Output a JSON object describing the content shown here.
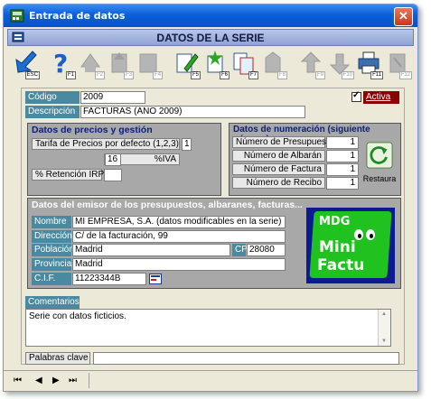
{
  "window": {
    "title": "Entrada de datos",
    "close_glyph": "✕"
  },
  "header": {
    "title": "DATOS DE LA SERIE"
  },
  "toolbar": {
    "buttons": [
      {
        "icon": "exit-icon",
        "key": "ESC"
      },
      {
        "icon": "help-icon",
        "key": "F1"
      },
      {
        "icon": "disabled-icon-1",
        "key": "F2"
      },
      {
        "icon": "disabled-icon-2",
        "key": "F3"
      },
      {
        "icon": "disabled-icon-3",
        "key": "F4"
      },
      {
        "icon": "edit-icon",
        "key": "F5"
      },
      {
        "icon": "new-icon",
        "key": "F6"
      },
      {
        "icon": "copy-icon",
        "key": "F7"
      },
      {
        "icon": "disabled-icon-4",
        "key": "F8"
      },
      {
        "icon": "disabled-icon-5",
        "key": "F9"
      },
      {
        "icon": "disabled-icon-6",
        "key": "F10"
      },
      {
        "icon": "print-icon",
        "key": "F11"
      },
      {
        "icon": "disabled-icon-7",
        "key": "F12"
      }
    ]
  },
  "form": {
    "codigo_label": "Código",
    "codigo_value": "2009",
    "descripcion_label": "Descripción",
    "descripcion_value": "FACTURAS (AÑO 2009)",
    "activa_label": "Activa",
    "activa_checked": "✓"
  },
  "precios": {
    "title": "Datos de precios y gestión",
    "tarifa_label": "Tarifa de Precios por defecto (1,2,3)",
    "tarifa_value": "1",
    "iva_label": "%IVA",
    "iva_value": "16",
    "irpf_label": "% Retención IRPF",
    "irpf_value": ""
  },
  "numeracion": {
    "title": "Datos de numeración (siguiente número)",
    "rows": [
      {
        "label": "Número de Presupuesto",
        "value": "1"
      },
      {
        "label": "Número de Albarán",
        "value": "1"
      },
      {
        "label": "Número de Factura",
        "value": "1"
      },
      {
        "label": "Número de Recibo",
        "value": "1"
      }
    ],
    "restaura_label": "Restaura"
  },
  "emisor": {
    "title": "Datos del emisor de los presupuestos, albaranes, facturas...",
    "nombre_label": "Nombre",
    "nombre_value": "MI EMPRESA, S.A. (datos modificables en la serie)",
    "direccion_label": "Dirección",
    "direccion_value": "C/ de la facturación, 99",
    "poblacion_label": "Población",
    "poblacion_value": "Madrid",
    "cp_label": "CP",
    "cp_value": "28080",
    "provincia_label": "Provincia",
    "provincia_value": "Madrid",
    "cif_label": "C.I.F.",
    "cif_value": "11223344B",
    "logo": {
      "line1": "MDG",
      "line2": "Mini",
      "line3": "Factu"
    }
  },
  "comentarios": {
    "label": "Comentarios",
    "value": "Serie con datos ficticios."
  },
  "palabras": {
    "label": "Palabras clave",
    "value": ""
  },
  "nav": {
    "first": "⏮",
    "prev": "◀",
    "next": "▶",
    "last": "⏭"
  },
  "colors": {
    "label_bg": "#4a8aa0",
    "group_bg": "#a8a8a8",
    "title_blue": "#0a5fd8",
    "activa_red": "#8b0000"
  }
}
